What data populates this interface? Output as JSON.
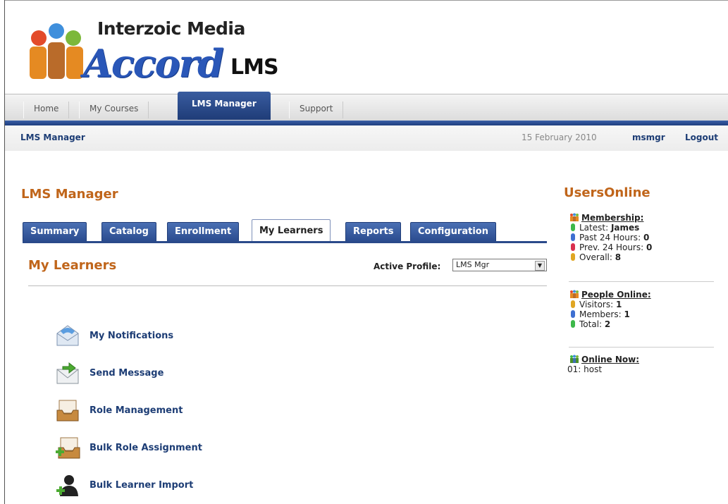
{
  "brand": {
    "top": "Interzoic Media",
    "main": "Accord",
    "sub": "LMS"
  },
  "topnav": {
    "tabs": [
      {
        "label": "Home"
      },
      {
        "label": "My Courses"
      },
      {
        "label": "LMS Manager",
        "active": true
      },
      {
        "label": "Support"
      }
    ]
  },
  "crumbbar": {
    "crumb": "LMS Manager",
    "date": "15 February 2010",
    "user": "msmgr",
    "logout": "Logout"
  },
  "main": {
    "title": "LMS Manager",
    "tabs": [
      {
        "label": "Summary"
      },
      {
        "label": "Catalog"
      },
      {
        "label": "Enrollment"
      },
      {
        "label": "My Learners",
        "active": true
      },
      {
        "label": "Reports"
      },
      {
        "label": "Configuration"
      }
    ],
    "section_title": "My Learners",
    "profile_label": "Active Profile:",
    "profile_value": "LMS Mgr",
    "links": [
      {
        "label": "My Notifications",
        "icon": "envelope-open-icon"
      },
      {
        "label": "Send Message",
        "icon": "send-message-icon"
      },
      {
        "label": "Role Management",
        "icon": "inbox-tray-icon"
      },
      {
        "label": "Bulk Role Assignment",
        "icon": "inbox-tray-add-icon"
      },
      {
        "label": "Bulk Learner Import",
        "icon": "user-add-icon"
      }
    ]
  },
  "users_online": {
    "title": "UsersOnline",
    "membership": {
      "heading": "Membership:",
      "latest_label": "Latest:",
      "latest_value": "James",
      "past24_label": "Past 24 Hours:",
      "past24_value": "0",
      "prev24_label": "Prev. 24 Hours:",
      "prev24_value": "0",
      "overall_label": "Overall:",
      "overall_value": "8"
    },
    "people": {
      "heading": "People Online:",
      "visitors_label": "Visitors:",
      "visitors_value": "1",
      "members_label": "Members:",
      "members_value": "1",
      "total_label": "Total:",
      "total_value": "2"
    },
    "online_now": {
      "heading": "Online Now:",
      "entry": "01: host"
    }
  },
  "colors": {
    "accent_orange": "#c0651a",
    "nav_blue": "#2a4a8a",
    "link_blue": "#1d3d75"
  }
}
